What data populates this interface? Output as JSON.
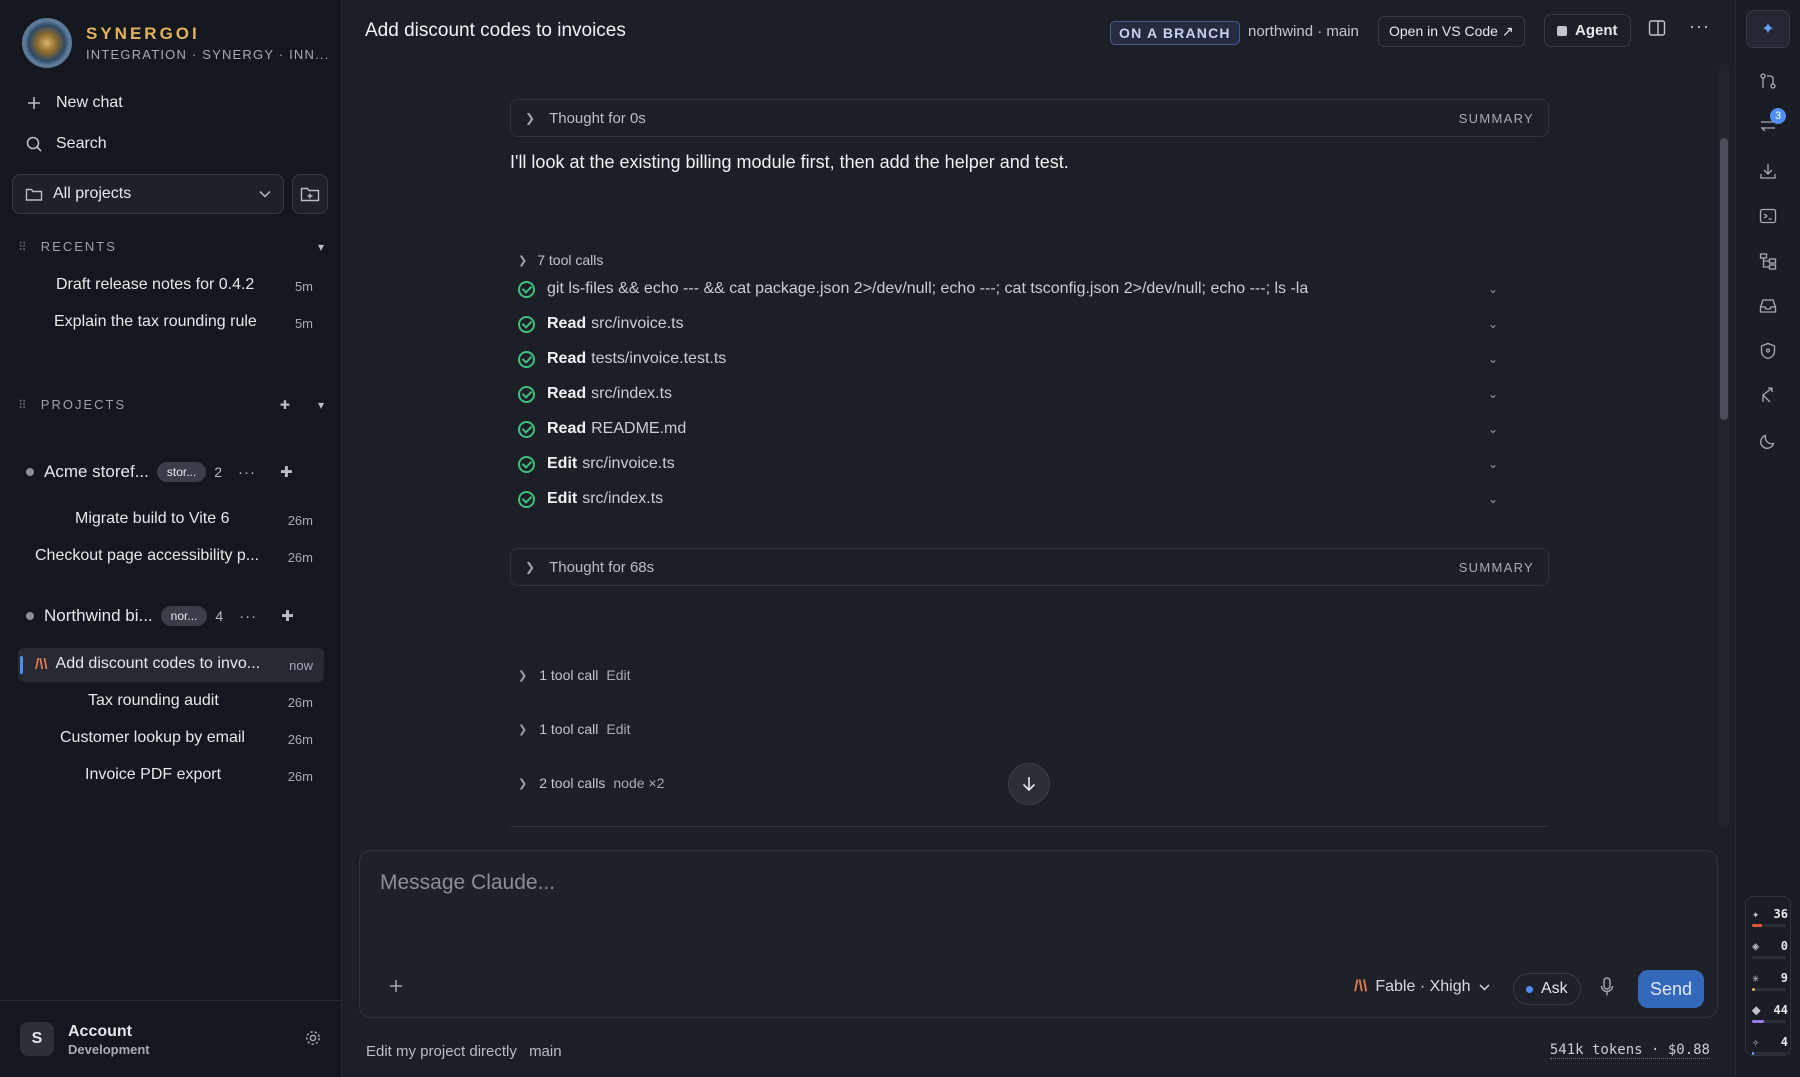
{
  "brand": {
    "name": "SYNERGOI",
    "subtitle": "INTEGRATION · SYNERGY · INN..."
  },
  "nav": {
    "new_chat": "New chat",
    "search": "Search"
  },
  "project_select": {
    "value": "All projects"
  },
  "recents": {
    "label": "RECENTS",
    "items": [
      {
        "label": "Draft release notes for 0.4.2",
        "age": "5m"
      },
      {
        "label": "Explain the tax rounding rule",
        "age": "5m"
      }
    ]
  },
  "projects": {
    "label": "PROJECTS",
    "groups": [
      {
        "name": "Acme storef...",
        "tag": "stor...",
        "count": "2",
        "chats": [
          {
            "label": "Migrate build to Vite 6",
            "age": "26m"
          },
          {
            "label": "Checkout page accessibility p...",
            "age": "26m"
          }
        ]
      },
      {
        "name": "Northwind bi...",
        "tag": "nor...",
        "count": "4",
        "chats": [
          {
            "label": "Add discount codes to invo...",
            "age": "now"
          },
          {
            "label": "Tax rounding audit",
            "age": "26m"
          },
          {
            "label": "Customer lookup by email",
            "age": "26m"
          },
          {
            "label": "Invoice PDF export",
            "age": "26m"
          }
        ]
      }
    ]
  },
  "account": {
    "initial": "S",
    "name": "Account",
    "sub": "Development"
  },
  "header": {
    "title": "Add discount codes to invoices",
    "branch_badge": "ON A BRANCH",
    "repo": "northwind · main",
    "vscode": "Open in VS Code ↗",
    "agent": "Agent"
  },
  "conversation": {
    "thought1": {
      "label": "Thought for 0s",
      "summary": "SUMMARY"
    },
    "message": "I'll look at the existing billing module first, then add the helper and test.",
    "tool_group": {
      "label": "7 tool calls",
      "calls": [
        {
          "verb": "",
          "target": "git ls-files && echo --- && cat package.json 2>/dev/null; echo ---; cat tsconfig.json 2>/dev/null; echo ---; ls -la"
        },
        {
          "verb": "Read",
          "target": "src/invoice.ts"
        },
        {
          "verb": "Read",
          "target": "tests/invoice.test.ts"
        },
        {
          "verb": "Read",
          "target": "src/index.ts"
        },
        {
          "verb": "Read",
          "target": "README.md"
        },
        {
          "verb": "Edit",
          "target": "src/invoice.ts"
        },
        {
          "verb": "Edit",
          "target": "src/index.ts"
        }
      ]
    },
    "thought2": {
      "label": "Thought for 68s",
      "summary": "SUMMARY"
    },
    "collapsed": [
      {
        "label": "1 tool call",
        "kind": "Edit"
      },
      {
        "label": "1 tool call",
        "kind": "Edit"
      },
      {
        "label": "2 tool calls",
        "kind": "node ×2"
      }
    ]
  },
  "composer": {
    "placeholder": "Message Claude...",
    "model": "Fable · Xhigh",
    "mode": "Ask",
    "send": "Send"
  },
  "footer": {
    "mode": "Edit my project directly",
    "branch": "main",
    "usage": "541k tokens · $0.88"
  },
  "rail": {
    "badge": "3",
    "stats": [
      {
        "symbol": "✦",
        "value": "36",
        "fill": 0.3,
        "color": "#e05a3a"
      },
      {
        "symbol": "◈",
        "value": "0",
        "fill": 0.0,
        "color": "#c0c6d0"
      },
      {
        "symbol": "✳",
        "value": "9",
        "fill": 0.08,
        "color": "#e2b35c"
      },
      {
        "symbol": "⬥",
        "value": "44",
        "fill": 0.35,
        "color": "#9b7bf0"
      },
      {
        "symbol": "✧",
        "value": "4",
        "fill": 0.05,
        "color": "#6aa3ff"
      }
    ]
  }
}
